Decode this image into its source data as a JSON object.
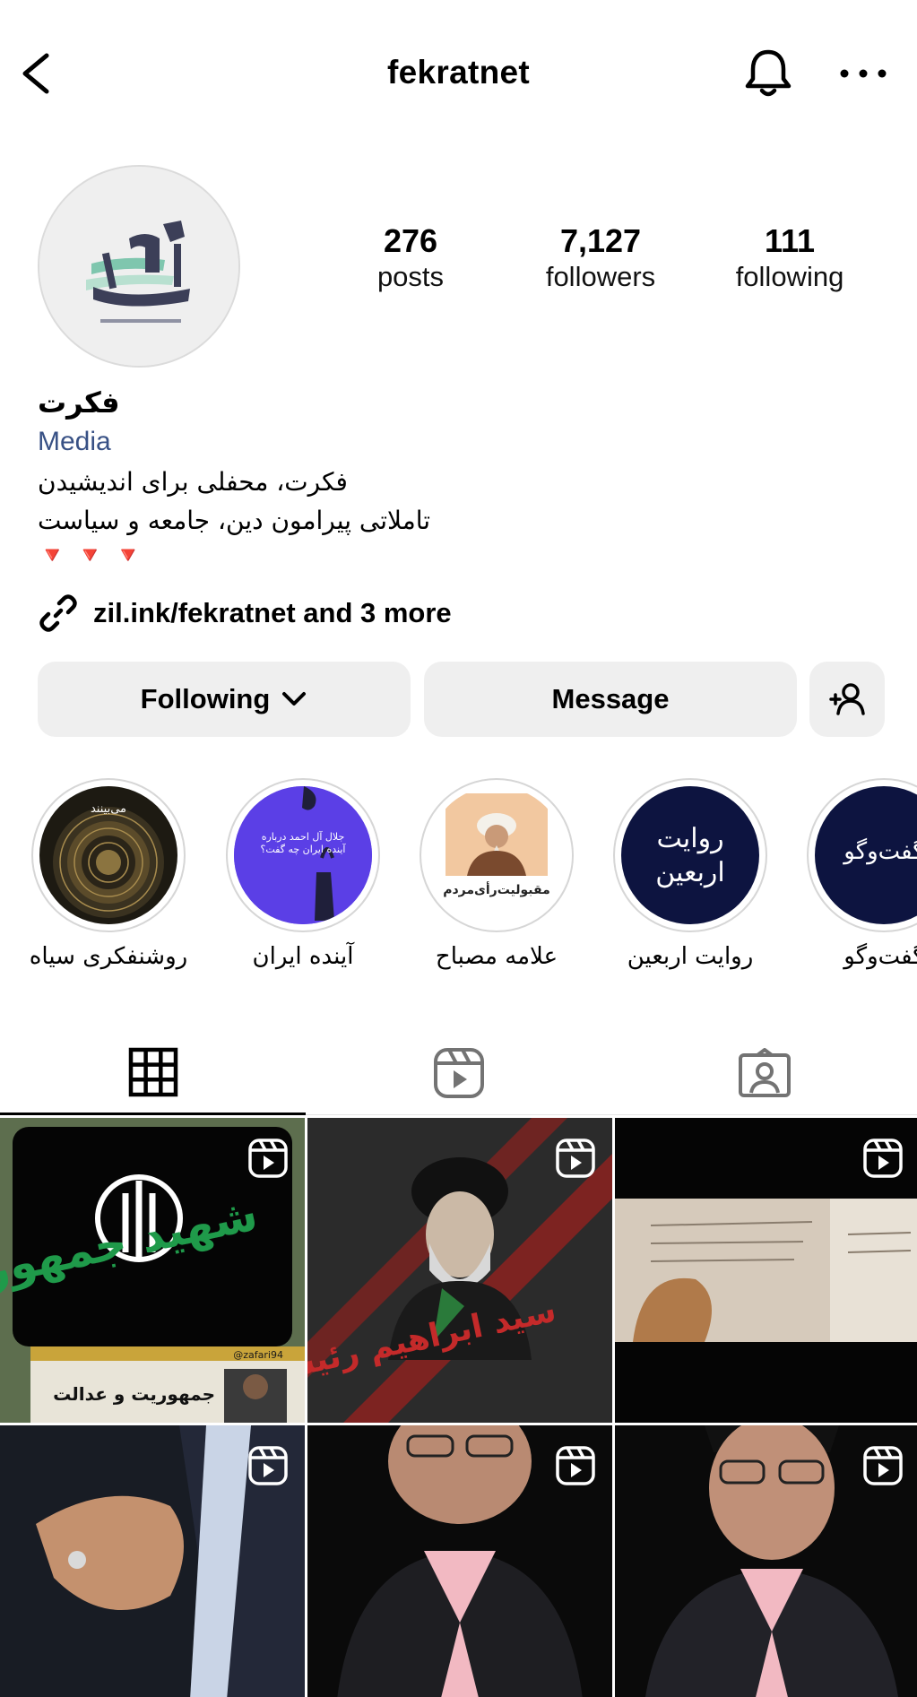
{
  "header": {
    "username": "fekratnet"
  },
  "profile": {
    "avatar_logo": "فکرت",
    "stats": [
      {
        "value": "276",
        "label": "posts"
      },
      {
        "value": "7,127",
        "label": "followers"
      },
      {
        "value": "111",
        "label": "following"
      }
    ],
    "full_name": "فکرت",
    "category": "Media",
    "bio_lines": [
      "فکرت، محفلی برای اندیشیدن",
      "تاملاتی پیرامون دین، جامعه و سیاست",
      "🔻🔻🔻"
    ],
    "link": "zil.ink/fekratnet and 3 more"
  },
  "actions": {
    "following_label": "Following",
    "message_label": "Message"
  },
  "highlights": [
    {
      "label": "روشنفکری سیاه",
      "cover_text": "می‌بینند"
    },
    {
      "label": "آینده ایران",
      "cover_text": "جلال آل احمد درباره آینده ایران چه گفت؟"
    },
    {
      "label": "علامه مصباح",
      "cover_text": "مقبولیت‌رأی‌مردم"
    },
    {
      "label": "روایت اربعین",
      "cover_text": "روایت اربعین"
    },
    {
      "label": "گفت‌وگو",
      "cover_text": "گفت‌وگو"
    }
  ],
  "tabs": [
    {
      "name": "grid-icon",
      "active": true
    },
    {
      "name": "reels-icon",
      "active": false
    },
    {
      "name": "tagged-icon",
      "active": false
    }
  ],
  "posts": [
    {
      "type": "reel",
      "caption_big": "شهید جمهور",
      "caption_title": "جمهوریت و عدالت",
      "caption_handle": "@zafari94"
    },
    {
      "type": "reel",
      "caption_big": "سید ابراهیم رئیسی"
    },
    {
      "type": "reel"
    },
    {
      "type": "reel"
    },
    {
      "type": "reel"
    },
    {
      "type": "reel"
    }
  ],
  "colors": {
    "link_blue": "#385185",
    "button_gray": "#efefef",
    "highlight_blue": "#0d1440",
    "highlight_purple": "#5b3fe6"
  }
}
